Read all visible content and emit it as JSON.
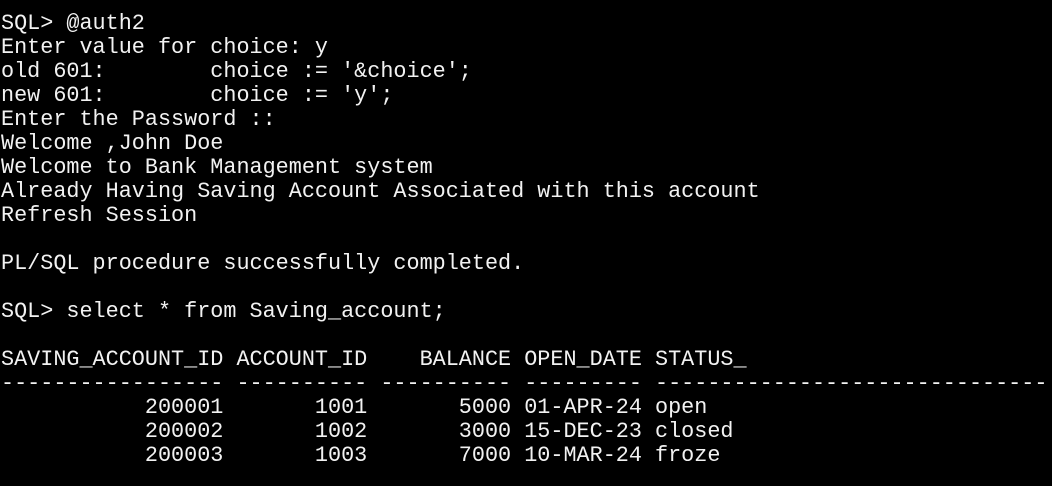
{
  "terminal": {
    "lines": [
      "SQL> @auth2",
      "Enter value for choice: y",
      "old 601:        choice := '&choice';",
      "new 601:        choice := 'y';",
      "Enter the Password ::",
      "Welcome ,John Doe",
      "Welcome to Bank Management system",
      "Already Having Saving Account Associated with this account",
      "Refresh Session",
      "",
      "PL/SQL procedure successfully completed.",
      "",
      "SQL> select * from Saving_account;",
      ""
    ],
    "table": {
      "header": "SAVING_ACCOUNT_ID ACCOUNT_ID    BALANCE OPEN_DATE STATUS_",
      "separator": "----------------- ---------- ---------- --------- ------------------------------",
      "rows": [
        "           200001       1001       5000 01-APR-24 open",
        "           200002       1002       3000 15-DEC-23 closed",
        "           200003       1003       7000 10-MAR-24 froze"
      ]
    }
  }
}
